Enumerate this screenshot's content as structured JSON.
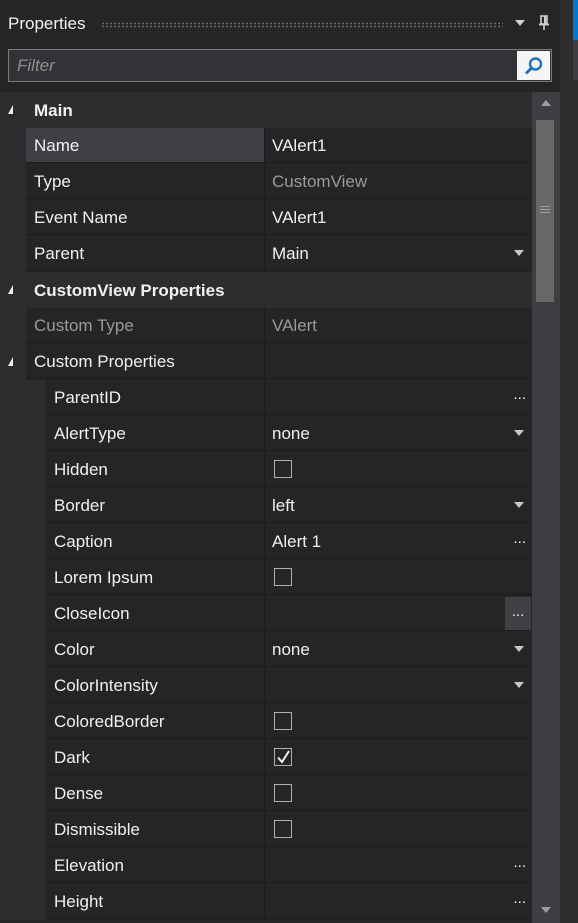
{
  "panel": {
    "title": "Properties"
  },
  "filter": {
    "placeholder": "Filter"
  },
  "categories": {
    "main": "Main",
    "customview": "CustomView Properties"
  },
  "main_props": {
    "name": {
      "label": "Name",
      "value": "VAlert1"
    },
    "type": {
      "label": "Type",
      "value": "CustomView"
    },
    "event_name": {
      "label": "Event Name",
      "value": "VAlert1"
    },
    "parent": {
      "label": "Parent",
      "value": "Main"
    }
  },
  "cv_props": {
    "custom_type": {
      "label": "Custom Type",
      "value": "VAlert"
    },
    "custom_properties": {
      "label": "Custom Properties"
    }
  },
  "custom": {
    "parent_id": {
      "label": "ParentID"
    },
    "alert_type": {
      "label": "AlertType",
      "value": "none"
    },
    "hidden": {
      "label": "Hidden",
      "checked": false
    },
    "border": {
      "label": "Border",
      "value": "left"
    },
    "caption": {
      "label": "Caption",
      "value": "Alert 1"
    },
    "lorem_ipsum": {
      "label": "Lorem Ipsum",
      "checked": false
    },
    "close_icon": {
      "label": "CloseIcon"
    },
    "color": {
      "label": "Color",
      "value": "none"
    },
    "color_intensity": {
      "label": "ColorIntensity",
      "value": ""
    },
    "colored_border": {
      "label": "ColoredBorder",
      "checked": false
    },
    "dark": {
      "label": "Dark",
      "checked": true
    },
    "dense": {
      "label": "Dense",
      "checked": false
    },
    "dismissible": {
      "label": "Dismissible",
      "checked": false
    },
    "elevation": {
      "label": "Elevation"
    },
    "height": {
      "label": "Height"
    }
  },
  "ellipsis": "...",
  "colors": {
    "accent": "#007acc",
    "background": "#252526",
    "selected": "#3f3f46"
  }
}
